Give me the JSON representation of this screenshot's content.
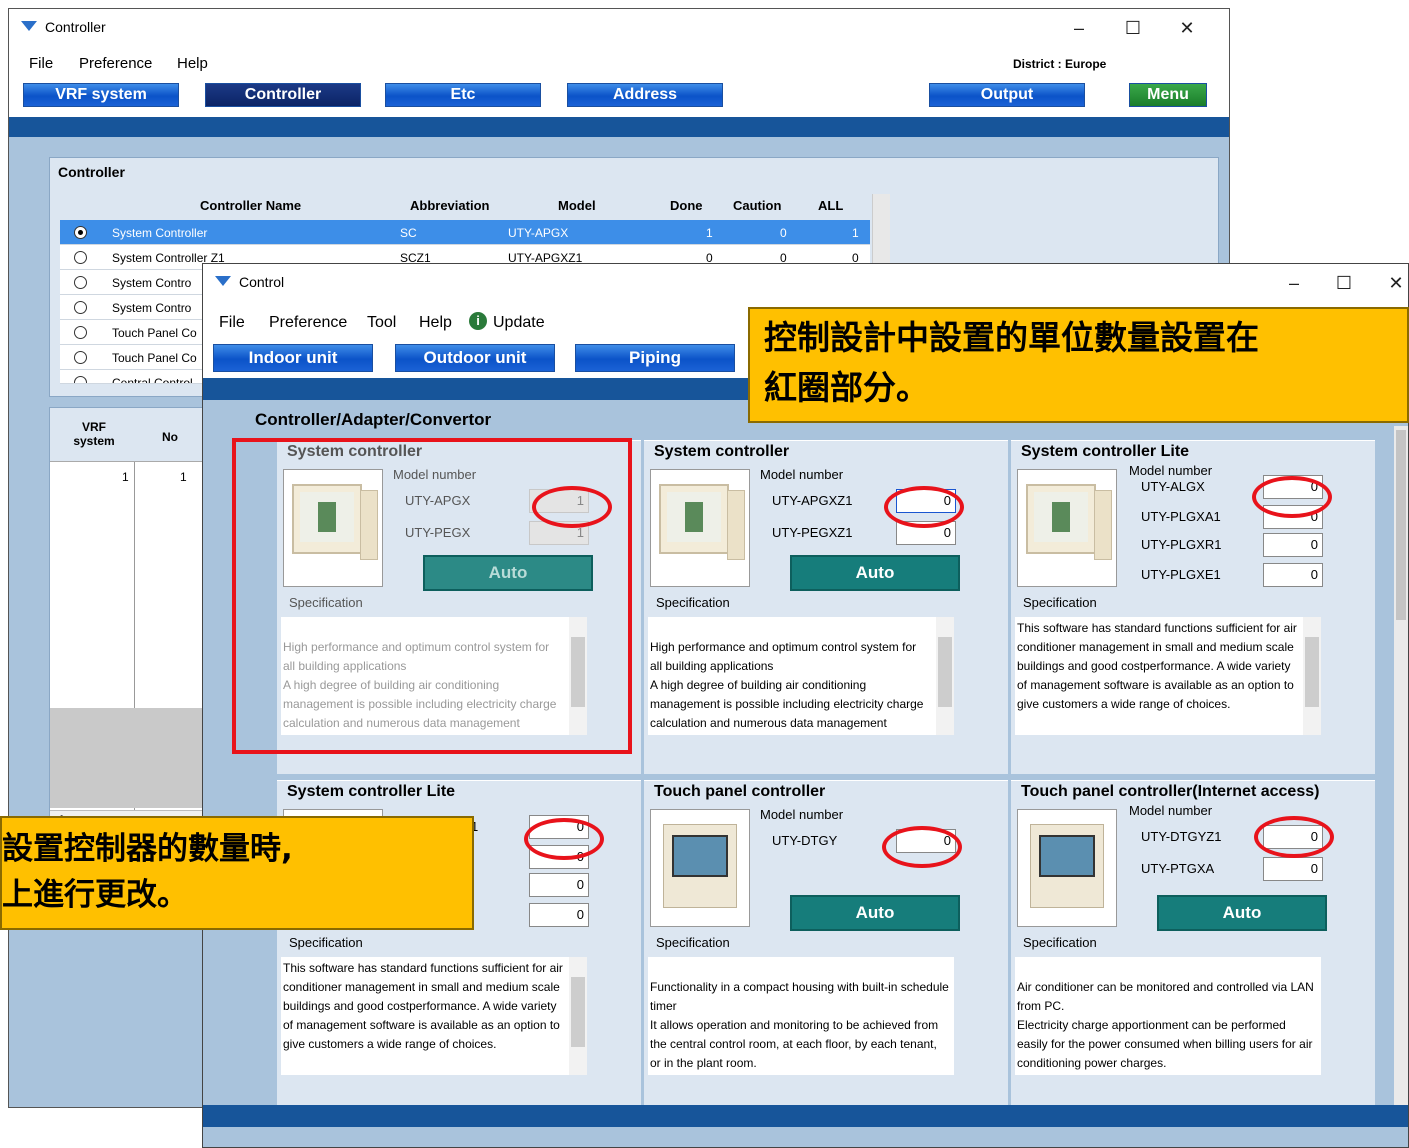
{
  "controller_window": {
    "title": "Controller",
    "menu": [
      "File",
      "Preference",
      "Help"
    ],
    "district": "District : Europe",
    "nav": [
      "VRF system",
      "Controller",
      "Etc",
      "Address",
      "Output",
      "Menu"
    ],
    "section_label": "Controller",
    "columns": [
      "Controller Name",
      "Abbreviation",
      "Model",
      "Done",
      "Caution",
      "ALL"
    ],
    "rows": [
      {
        "name": "System Controller",
        "abbr": "SC",
        "model": "UTY-APGX",
        "done": "1",
        "caution": "0",
        "all": "1",
        "selected": true
      },
      {
        "name": "System Controller Z1",
        "abbr": "SCZ1",
        "model": "UTY-APGXZ1",
        "done": "0",
        "caution": "0",
        "all": "0"
      },
      {
        "name": "System Contro",
        "abbr": "",
        "model": "",
        "done": "",
        "caution": "",
        "all": ""
      },
      {
        "name": "System Contro",
        "abbr": "",
        "model": "",
        "done": "",
        "caution": "",
        "all": ""
      },
      {
        "name": "Touch Panel Co",
        "abbr": "",
        "model": "",
        "done": "",
        "caution": "",
        "all": ""
      },
      {
        "name": "Touch Panel Co",
        "abbr": "",
        "model": "",
        "done": "",
        "caution": "",
        "all": ""
      },
      {
        "name": "Central Control",
        "abbr": "",
        "model": "",
        "done": "",
        "caution": "",
        "all": ""
      }
    ],
    "lower_columns": [
      "VRF\nsystem",
      "No"
    ],
    "lower_row": [
      "1",
      "1"
    ]
  },
  "control_window": {
    "title": "Control",
    "menu": [
      "File",
      "Preference",
      "Tool",
      "Help",
      "Update"
    ],
    "nav": [
      "Indoor unit",
      "Outdoor unit",
      "Piping"
    ],
    "section_label": "Controller/Adapter/Convertor",
    "model_number_label": "Model number",
    "auto_label": "Auto",
    "spec_label": "Specification",
    "cards": [
      {
        "title": "System controller",
        "models": [
          {
            "name": "UTY-APGX",
            "value": "1"
          },
          {
            "name": "UTY-PEGX",
            "value": "1"
          }
        ],
        "desc": "High performance and optimum control system for all building applications\nA high degree of building air conditioning management is possible including electricity charge calculation and numerous data management functions as well as standard"
      },
      {
        "title": "System controller",
        "models": [
          {
            "name": "UTY-APGXZ1",
            "value": "0"
          },
          {
            "name": "UTY-PEGXZ1",
            "value": "0"
          }
        ],
        "desc": "High performance and optimum control system for all building applications\nA high degree of building air conditioning management is possible including electricity charge calculation and numerous data management functions as well as standard"
      },
      {
        "title": "System controller Lite",
        "models": [
          {
            "name": "UTY-ALGX",
            "value": "0"
          },
          {
            "name": "UTY-PLGXA1",
            "value": "0"
          },
          {
            "name": "UTY-PLGXR1",
            "value": "0"
          },
          {
            "name": "UTY-PLGXE1",
            "value": "0"
          }
        ],
        "desc": "This software has standard functions sufficient for air conditioner management in small and medium scale buildings and good costperformance. A wide variety of management software is available as an option to give customers a wide range of choices."
      },
      {
        "title": "System controller Lite",
        "models": [
          {
            "name": "Z1",
            "value": "0"
          },
          {
            "name": "2",
            "value": "0"
          },
          {
            "name": "2",
            "value": "0"
          },
          {
            "name": "2",
            "value": "0"
          }
        ],
        "desc": "This software has standard functions sufficient for air conditioner management in small and medium scale buildings and good costperformance. A wide variety of management software is available as an option to give customers a wide range of choices."
      },
      {
        "title": "Touch panel controller",
        "models": [
          {
            "name": "UTY-DTGY",
            "value": "0"
          }
        ],
        "desc": "Functionality in a compact housing with built-in schedule timer\nIt allows operation and monitoring to be achieved from the central control room, at each floor, by each tenant, or in the plant room."
      },
      {
        "title": "Touch panel controller(Internet access)",
        "models": [
          {
            "name": "UTY-DTGYZ1",
            "value": "0"
          },
          {
            "name": "UTY-PTGXA",
            "value": "0"
          }
        ],
        "desc": "Air conditioner can be monitored and controlled via LAN from PC.\nElectricity charge apportionment can be performed easily for the power consumed when billing users for air conditioning power charges.\n(Option:UTY-PTGXA)"
      }
    ]
  },
  "annotations": {
    "callout_top": "控制設計中設置的單位數量設置在\n紅圈部分。",
    "callout_left": "設置控制器的數量時,\n上進行更改。"
  },
  "colors": {
    "nav_blue": "#0b53c8",
    "auto_teal": "#167d7b",
    "panel_bg": "#a9c3dc",
    "highlight_red": "#e8131b",
    "callout_yellow": "#ffc000"
  }
}
